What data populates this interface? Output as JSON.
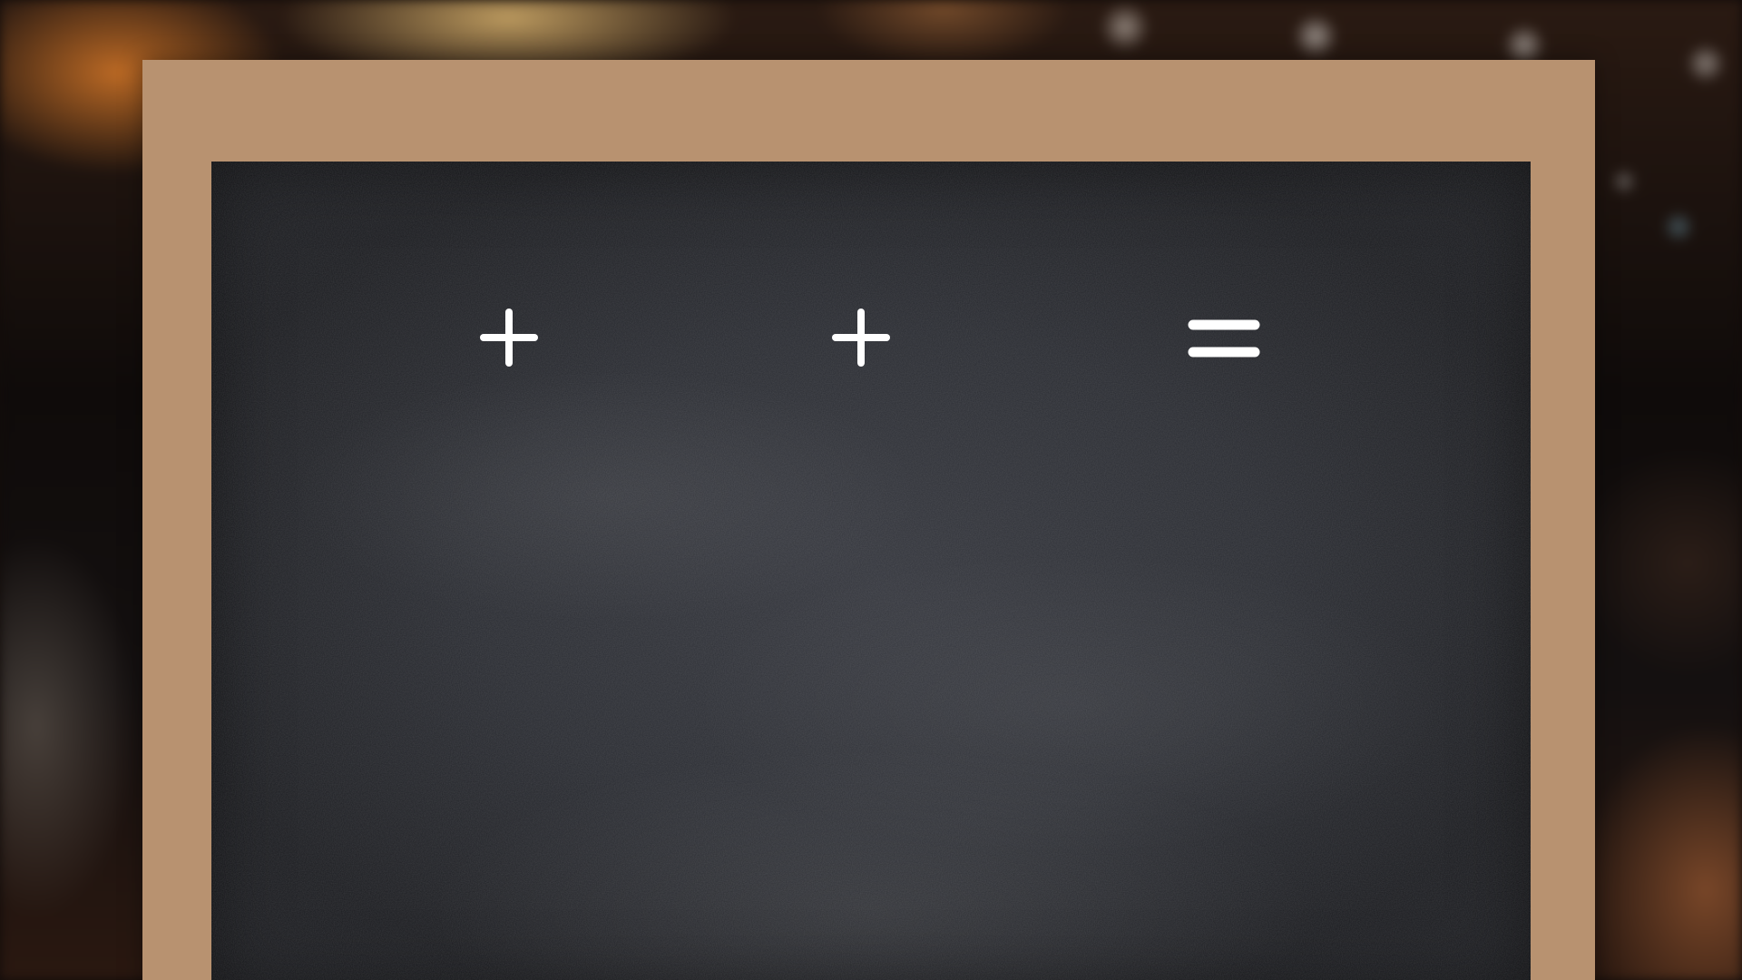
{
  "board": {
    "frame_color": "#b89270",
    "surface_color": "#2c2e34",
    "chalk_color": "#ffffff"
  },
  "equation": {
    "symbols": [
      {
        "name": "plus-icon"
      },
      {
        "name": "plus-icon"
      },
      {
        "name": "equals-icon"
      }
    ]
  }
}
